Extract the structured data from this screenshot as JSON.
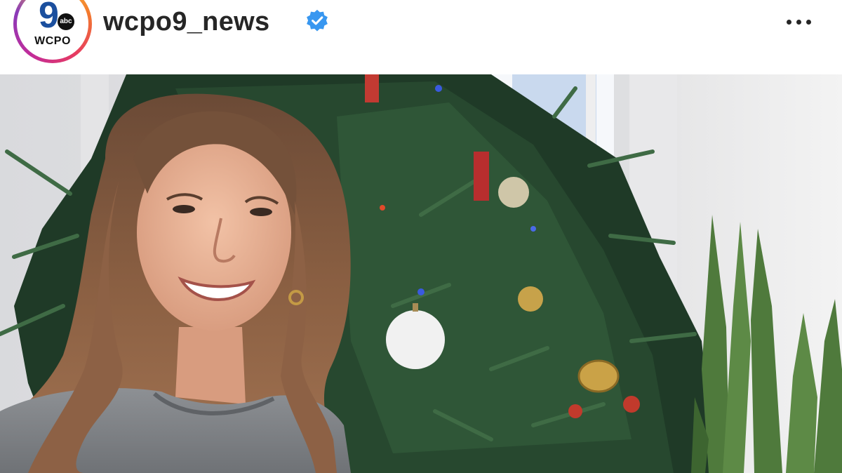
{
  "post": {
    "username": "wcpo9_news",
    "verified": true,
    "avatar": {
      "logo_number": "9",
      "logo_abc": "abc",
      "logo_text": "WCPO"
    },
    "icons": {
      "verified": "verified-badge-icon",
      "more": "more-options-icon"
    },
    "colors": {
      "verified": "#3897f0",
      "username": "#262626"
    }
  }
}
